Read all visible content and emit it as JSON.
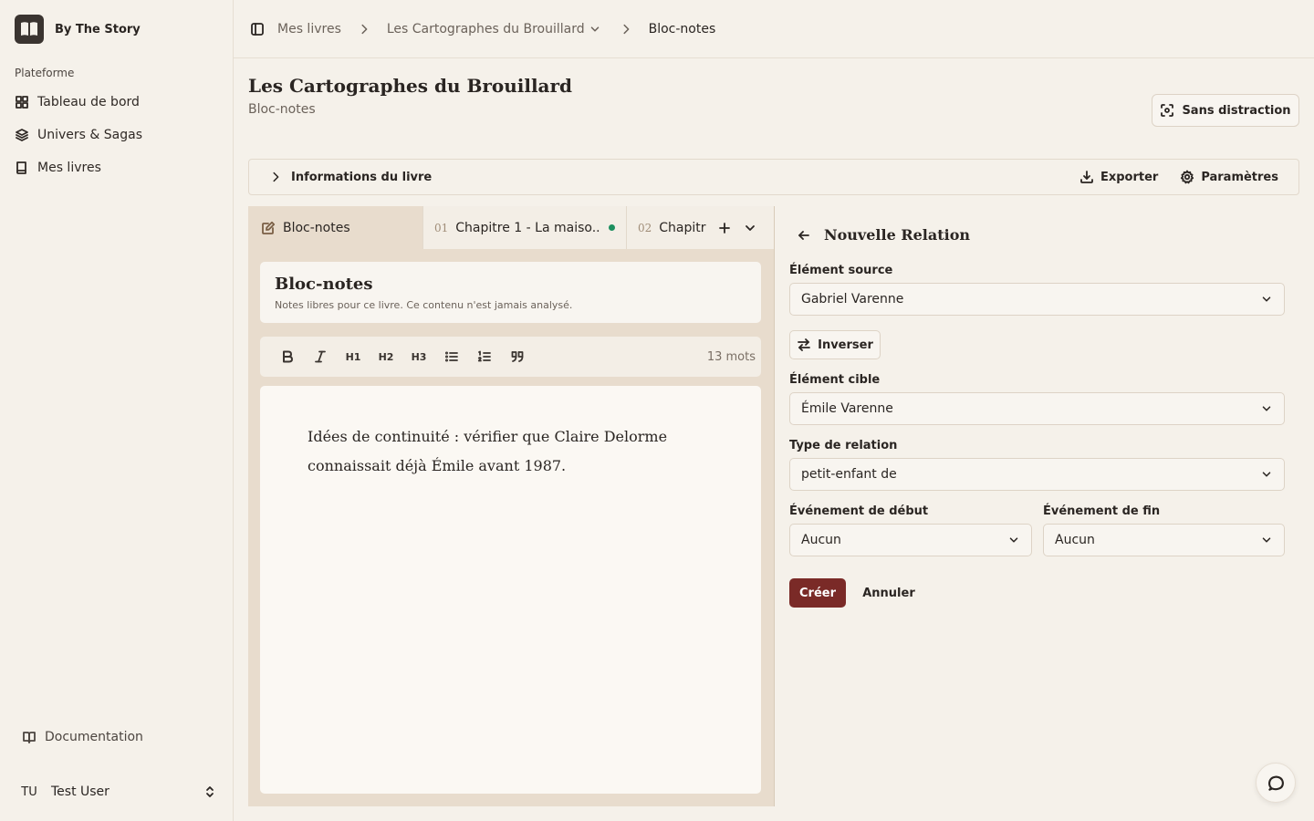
{
  "app": {
    "name": "By The Story"
  },
  "sidebar": {
    "group_label": "Plateforme",
    "items": [
      {
        "label": "Tableau de bord",
        "icon": "grid-icon"
      },
      {
        "label": "Univers & Sagas",
        "icon": "layers-icon"
      },
      {
        "label": "Mes livres",
        "icon": "book-icon"
      }
    ],
    "documentation_label": "Documentation",
    "user": {
      "initials": "TU",
      "name": "Test User"
    }
  },
  "breadcrumb": {
    "items": [
      "Mes livres",
      "Les Cartographes du Brouillard",
      "Bloc-notes"
    ]
  },
  "page": {
    "title": "Les Cartographes du Brouillard",
    "subtitle": "Bloc-notes",
    "distraction_free_label": "Sans distraction"
  },
  "info_bar": {
    "label": "Informations du livre",
    "export_label": "Exporter",
    "settings_label": "Paramètres"
  },
  "tabs": [
    {
      "label": "Bloc-notes",
      "number": ""
    },
    {
      "label": "Chapitre 1 - La maiso...",
      "number": "01"
    },
    {
      "label": "Chapitr",
      "number": "02"
    }
  ],
  "notepad": {
    "title": "Bloc-notes",
    "description": "Notes libres pour ce livre. Ce contenu n'est jamais analysé.",
    "word_count": "13 mots",
    "content": "Idées de continuité : vérifier que Claire Delorme connaissait déjà Émile avant 1987."
  },
  "toolbar": {
    "h1": "H1",
    "h2": "H2",
    "h3": "H3"
  },
  "relation_form": {
    "title": "Nouvelle Relation",
    "source_label": "Élément source",
    "source_value": "Gabriel Varenne",
    "swap_label": "Inverser",
    "target_label": "Élément cible",
    "target_value": "Émile Varenne",
    "type_label": "Type de relation",
    "type_value": "petit-enfant de",
    "start_label": "Événement de début",
    "start_value": "Aucun",
    "end_label": "Événement de fin",
    "end_value": "Aucun",
    "create_label": "Créer",
    "cancel_label": "Annuler"
  },
  "colors": {
    "primary": "#7a2a27",
    "background": "#f5f1ea",
    "status_dot": "#1c8f5f"
  }
}
